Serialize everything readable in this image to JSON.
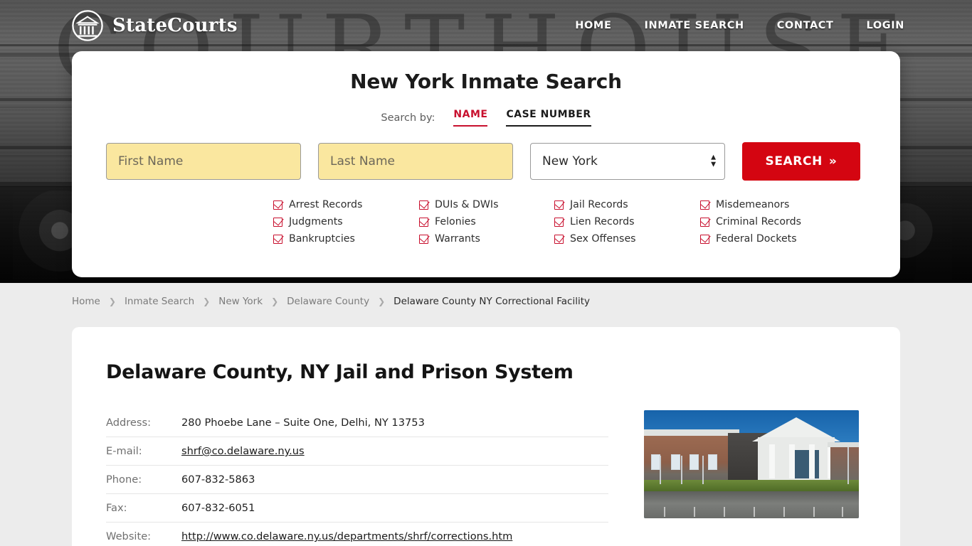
{
  "header": {
    "brand_name": "StateCourts",
    "logo_icon": "courthouse-circle-icon",
    "nav": [
      {
        "label": "HOME",
        "name": "home"
      },
      {
        "label": "INMATE SEARCH",
        "name": "inmate-search"
      },
      {
        "label": "CONTACT",
        "name": "contact"
      },
      {
        "label": "LOGIN",
        "name": "login"
      }
    ]
  },
  "hero": {
    "watermark_text": "COURTHOUSE"
  },
  "search": {
    "title": "New York Inmate Search",
    "search_by_label": "Search by:",
    "tabs": [
      {
        "label": "NAME",
        "active": true,
        "color": "#c8102e"
      },
      {
        "label": "CASE NUMBER",
        "active": false,
        "color": "#1b1b1b"
      }
    ],
    "first_name_placeholder": "First Name",
    "first_name_value": "",
    "last_name_placeholder": "Last Name",
    "last_name_value": "",
    "state_selected": "New York",
    "state_options": [
      "New York"
    ],
    "submit_label": "SEARCH",
    "submit_chevron": "»",
    "accent_color": "#d40511",
    "field_color": "#fae79f",
    "features": [
      "Arrest Records",
      "DUIs & DWIs",
      "Jail Records",
      "Misdemeanors",
      "Judgments",
      "Felonies",
      "Lien Records",
      "Criminal Records",
      "Bankruptcies",
      "Warrants",
      "Sex Offenses",
      "Federal Dockets"
    ]
  },
  "breadcrumb": {
    "separator": "❯",
    "items": [
      {
        "label": "Home",
        "current": false
      },
      {
        "label": "Inmate Search",
        "current": false
      },
      {
        "label": "New York",
        "current": false
      },
      {
        "label": "Delaware County",
        "current": false
      },
      {
        "label": "Delaware County NY Correctional Facility",
        "current": true
      }
    ]
  },
  "facility": {
    "title": "Delaware County, NY Jail and Prison System",
    "rows": [
      {
        "label": "Address:",
        "value": "280 Phoebe Lane – Suite One, Delhi, NY 13753",
        "link": false
      },
      {
        "label": "E-mail:",
        "value": "shrf@co.delaware.ny.us",
        "link": true
      },
      {
        "label": "Phone:",
        "value": "607-832-5863",
        "link": false
      },
      {
        "label": "Fax:",
        "value": "607-832-6051",
        "link": false
      },
      {
        "label": "Website:",
        "value": "http://www.co.delaware.ny.us/departments/shrf/corrections.htm",
        "link": true
      }
    ],
    "photo_alt": "Delaware County correctional facility building exterior"
  }
}
